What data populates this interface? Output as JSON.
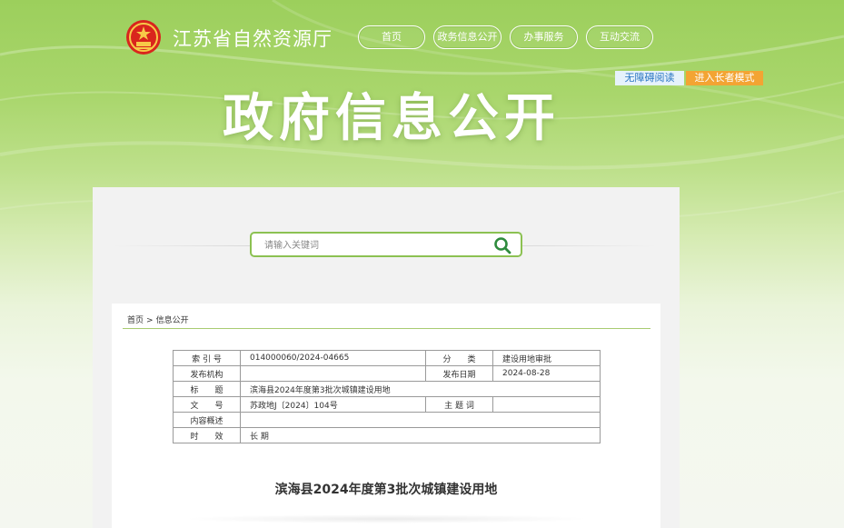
{
  "header": {
    "site_name": "江苏省自然资源厅",
    "nav": [
      "首页",
      "政务信息公开",
      "办事服务",
      "互动交流"
    ],
    "accessibility_label": "无障碍阅读",
    "elder_mode_label": "进入长者模式",
    "hero_title": "政府信息公开"
  },
  "search": {
    "placeholder": "请输入关键词",
    "icon": "search-icon"
  },
  "breadcrumb": {
    "home": "首页",
    "separator": ">",
    "current": "信息公开"
  },
  "meta_table": {
    "rows": [
      {
        "label": "索 引 号",
        "value": "014000060/2024-04665",
        "label2": "分　　类",
        "value2": "建设用地审批"
      },
      {
        "label": "发布机构",
        "value": "",
        "label2": "发布日期",
        "value2": "2024-08-28"
      },
      {
        "label": "标　　题",
        "value": "滨海县2024年度第3批次城镇建设用地"
      },
      {
        "label": "文　　号",
        "value": "苏政地J〔2024〕104号",
        "label2": "主 题 词",
        "value2": ""
      },
      {
        "label": "内容概述",
        "value": ""
      },
      {
        "label": "时　　效",
        "value": "长 期"
      }
    ]
  },
  "document": {
    "title": "滨海县2024年度第3批次城镇建设用地"
  },
  "colors": {
    "accent_green": "#8cc152",
    "elder_orange": "#f3a433",
    "access_blue": "#2a75c2"
  }
}
